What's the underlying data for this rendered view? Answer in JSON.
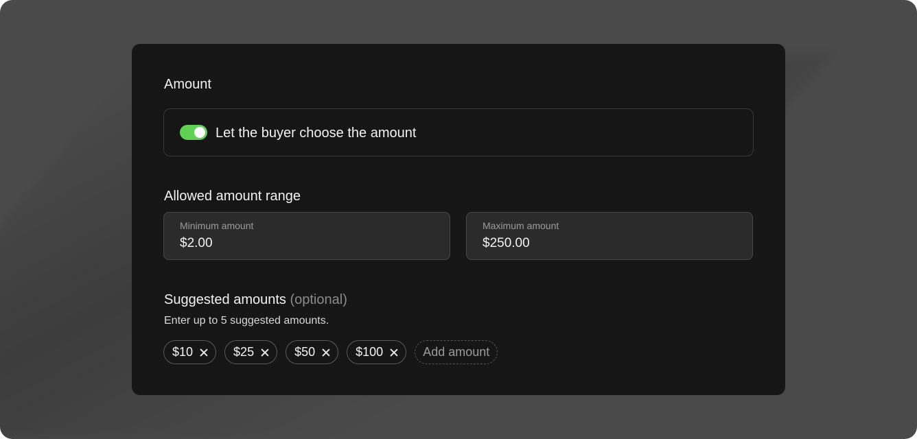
{
  "amount_section": {
    "title": "Amount",
    "toggle": {
      "label": "Let the buyer choose the amount",
      "enabled": true,
      "color": "#5fd255"
    }
  },
  "range_section": {
    "title": "Allowed amount range",
    "minimum": {
      "label": "Minimum amount",
      "value": "$2.00"
    },
    "maximum": {
      "label": "Maximum amount",
      "value": "$250.00"
    }
  },
  "suggested_section": {
    "title": "Suggested amounts",
    "optional_label": "(optional)",
    "helper": "Enter up to 5 suggested amounts.",
    "chips": [
      {
        "label": "$10",
        "remove_icon": "close-icon"
      },
      {
        "label": "$25",
        "remove_icon": "close-icon"
      },
      {
        "label": "$50",
        "remove_icon": "close-icon"
      },
      {
        "label": "$100",
        "remove_icon": "close-icon"
      }
    ],
    "add_label": "Add amount"
  }
}
